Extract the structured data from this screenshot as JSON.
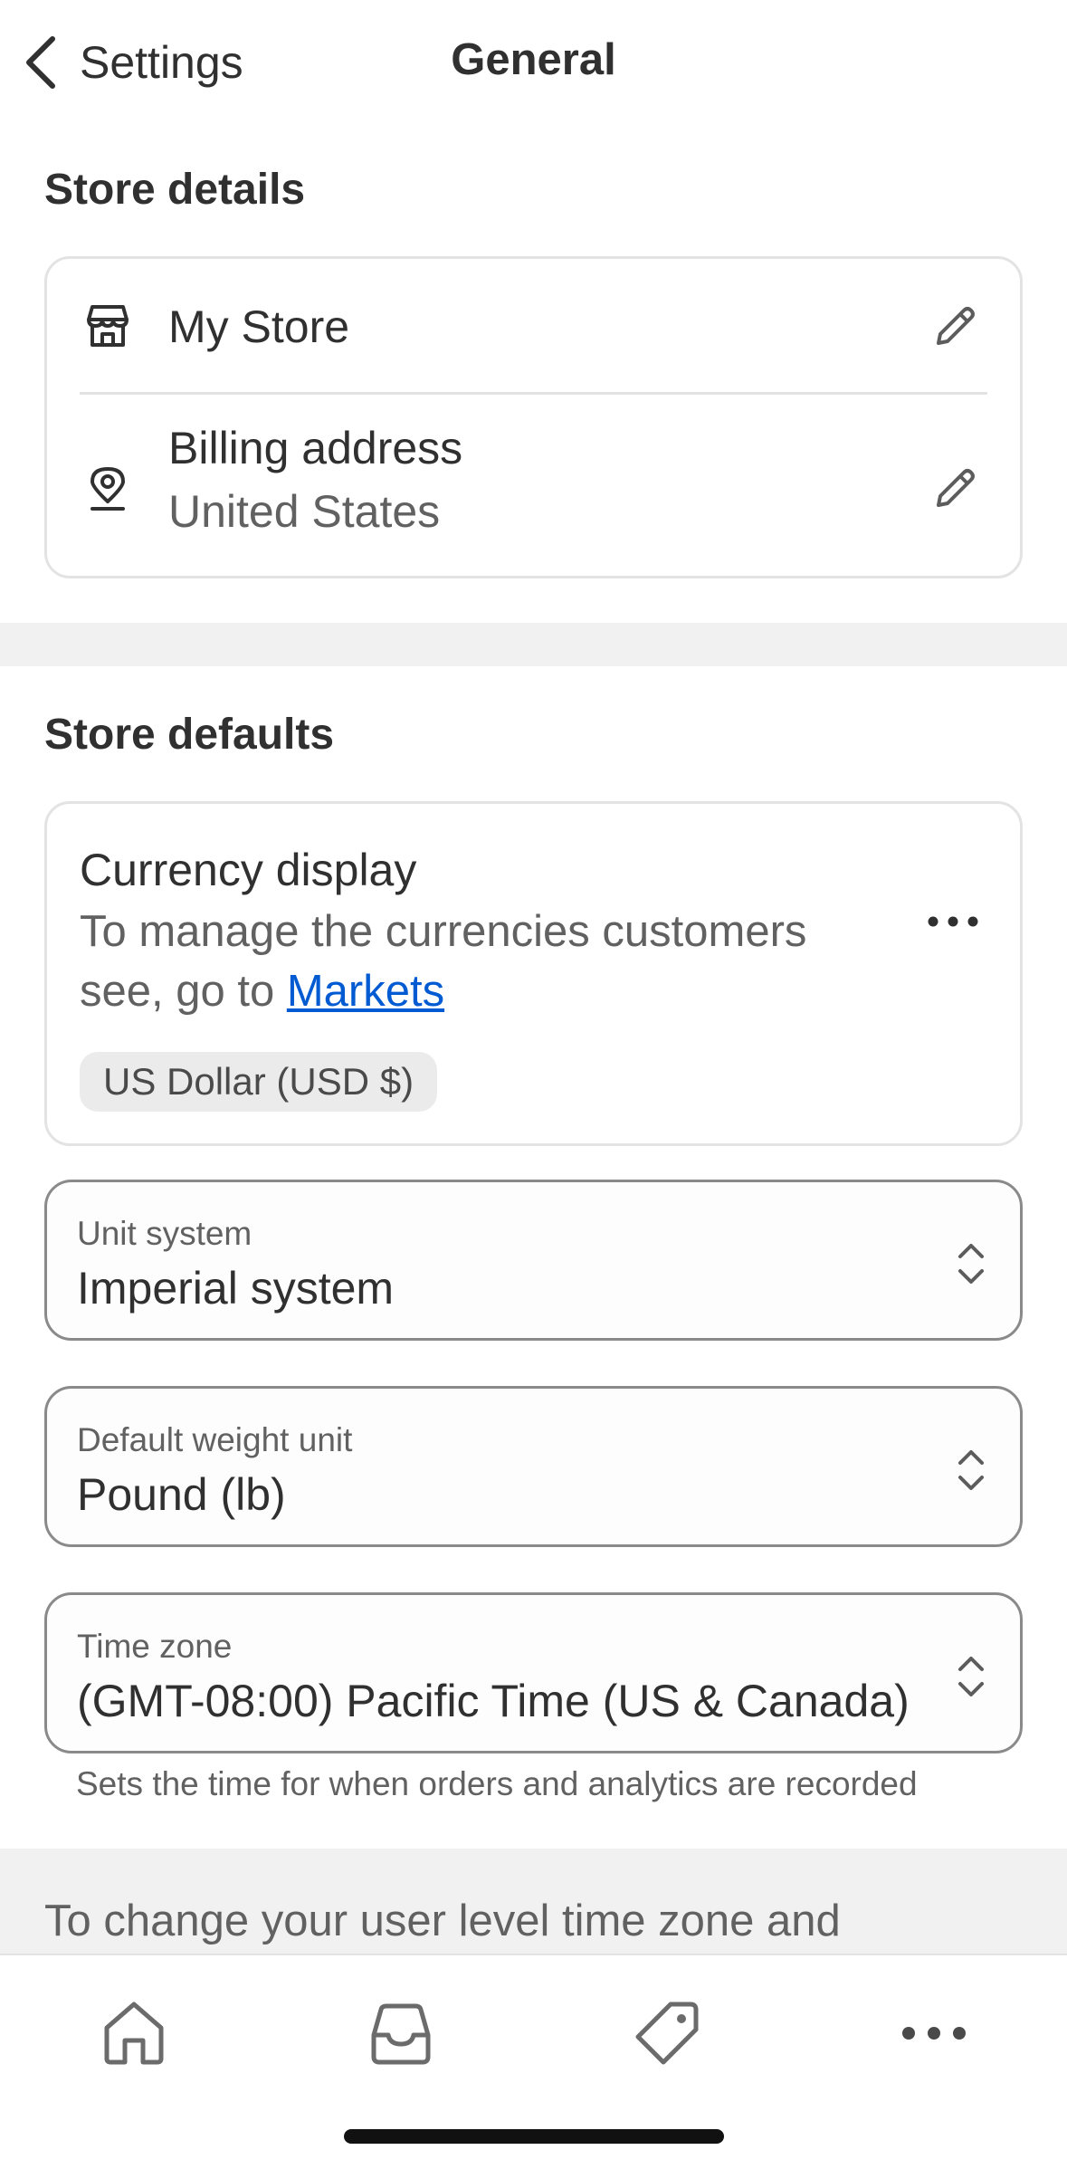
{
  "header": {
    "back_label": "Settings",
    "title": "General"
  },
  "store_details": {
    "section_title": "Store details",
    "store_name": "My Store",
    "billing_label": "Billing address",
    "billing_value": "United States"
  },
  "store_defaults": {
    "section_title": "Store defaults",
    "currency": {
      "title": "Currency display",
      "desc_prefix": "To manage the currencies customers see, go to ",
      "link_label": "Markets",
      "badge": "US Dollar (USD $)"
    },
    "unit_system": {
      "label": "Unit system",
      "value": "Imperial system"
    },
    "weight_unit": {
      "label": "Default weight unit",
      "value": "Pound (lb)"
    },
    "time_zone": {
      "label": "Time zone",
      "value": "(GMT-08:00) Pacific Time (US & Canada)",
      "helper": "Sets the time for when orders and analytics are recorded"
    }
  },
  "tip": {
    "text": "To change your user level time zone and"
  },
  "tabbar": {
    "items": [
      "home-icon",
      "inbox-icon",
      "tag-icon",
      "more-icon"
    ]
  },
  "colors": {
    "link": "#005bd3",
    "text": "#303030",
    "subdued": "#616161",
    "border": "#e3e3e3"
  }
}
